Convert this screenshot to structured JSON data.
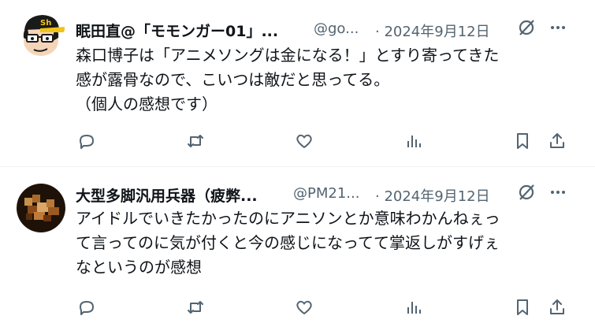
{
  "colors": {
    "text": "#0f1419",
    "secondary": "#536471",
    "divider": "#eff3f4"
  },
  "tweets": [
    {
      "display_name": "眠田直@「モモンガー01」...",
      "handle": "@go...",
      "date": "· 2024年9月12日",
      "text": "森口博子は「アニメソングは金になる！」とすり寄ってきた\n感が露骨なので、こいつは敵だと思ってる。\n（個人の感想です）",
      "avatar": "cartoon-avatar-with-cap"
    },
    {
      "display_name": "大型多脚汎用兵器（疲弊...",
      "handle": "@PM21...",
      "date": "· 2024年9月12日",
      "text": "アイドルでいきたかったのにアニソンとか意味わかんねぇっ\nて言ってのに気が付くと今の感じになってて掌返しがすげぇ\nなというのが感想",
      "avatar": "pixel-art-avatar"
    }
  ],
  "icons": {
    "reply": "reply-icon",
    "retweet": "retweet-icon",
    "like": "heart-icon",
    "views": "views-icon",
    "bookmark": "bookmark-icon",
    "share": "share-icon",
    "grok": "grok-icon",
    "more": "more-icon"
  }
}
